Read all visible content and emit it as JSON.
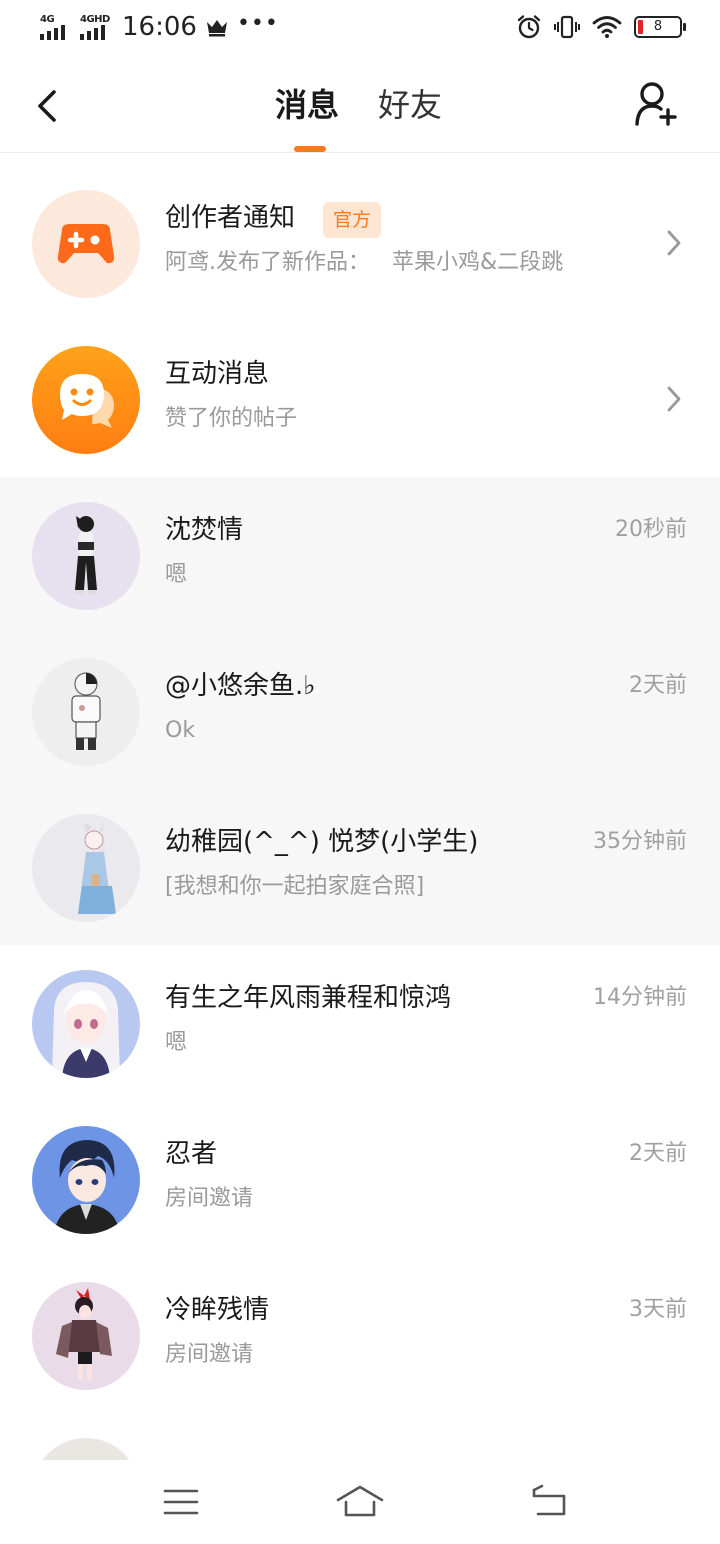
{
  "status_bar": {
    "network_1": "4G",
    "network_2": "4GHD",
    "time": "16:06",
    "battery_level": "8",
    "icons": [
      "crown-icon",
      "more-dots-icon",
      "alarm-icon",
      "vibrate-icon",
      "wifi-icon",
      "battery-icon"
    ]
  },
  "header": {
    "back_icon": "back-arrow-icon",
    "tabs": [
      {
        "label": "消息",
        "active": true
      },
      {
        "label": "好友",
        "active": false
      }
    ],
    "add_friend_icon": "add-friend-icon",
    "accent_color": "#ff7a1a"
  },
  "conversations": [
    {
      "name": "创作者通知",
      "badge": "官方",
      "preview": "阿鸢.发布了新作品：",
      "preview_title": "苹果小鸡&二段跳",
      "time": "",
      "avatar": "gamepad-icon",
      "pinned": false
    },
    {
      "name": "互动消息",
      "preview": "赞了你的帖子",
      "time": "",
      "avatar": "chat-smile-icon",
      "pinned": false
    },
    {
      "name": "沈焚情",
      "preview": "嗯",
      "time": "20秒前",
      "avatar": "user-avatar",
      "pinned": true
    },
    {
      "name": "@小悠余鱼.♭",
      "preview": "Ok",
      "time": "2天前",
      "avatar": "user-avatar",
      "pinned": true
    },
    {
      "name": "幼稚园(^_^) 悦梦(小学生)",
      "preview": "[我想和你一起拍家庭合照]",
      "time": "35分钟前",
      "avatar": "user-avatar",
      "pinned": true
    },
    {
      "name": "有生之年风雨兼程和惊鸿",
      "preview": "嗯",
      "time": "14分钟前",
      "avatar": "user-avatar",
      "pinned": false
    },
    {
      "name": "忍者",
      "preview": "房间邀请",
      "time": "2天前",
      "avatar": "user-avatar",
      "pinned": false
    },
    {
      "name": "冷眸残情",
      "preview": "房间邀请",
      "time": "3天前",
      "avatar": "user-avatar",
      "pinned": false
    }
  ],
  "bottom_nav": {
    "icons": [
      "menu-icon",
      "home-icon",
      "return-icon"
    ]
  }
}
